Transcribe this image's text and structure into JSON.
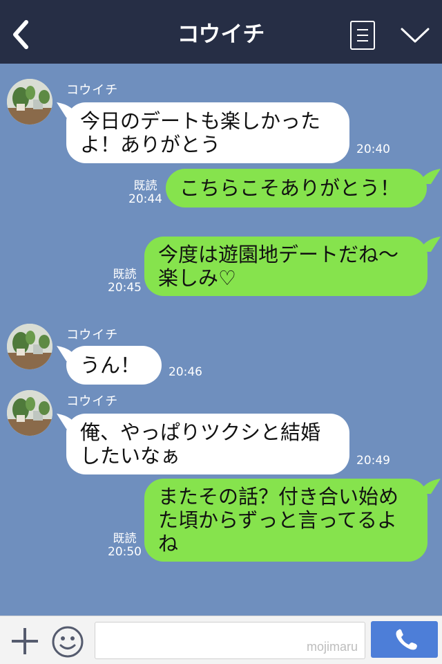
{
  "header": {
    "title": "コウイチ",
    "back_icon": "chevron-left-icon",
    "menu_icon": "list-menu-icon",
    "expand_icon": "chevron-down-icon"
  },
  "colors": {
    "header_bg": "#262e45",
    "chat_bg": "#6f8fbe",
    "incoming_bubble": "#ffffff",
    "outgoing_bubble": "#86e34d",
    "call_button": "#4d7ed8"
  },
  "messages": [
    {
      "direction": "in",
      "sender": "コウイチ",
      "lines": [
        "今日のデートも楽しかった",
        "よ！ありがとう"
      ],
      "time": "20:40"
    },
    {
      "direction": "out",
      "read": "既読",
      "lines": [
        "こちらこそありがとう！"
      ],
      "time": "20:44"
    },
    {
      "direction": "out",
      "read": "既読",
      "lines": [
        "今度は遊園地デートだね〜",
        "楽しみ♡"
      ],
      "time": "20:45"
    },
    {
      "direction": "in",
      "sender": "コウイチ",
      "lines": [
        "うん！"
      ],
      "time": "20:46"
    },
    {
      "direction": "in",
      "sender": "コウイチ",
      "lines": [
        "俺、やっぱりツクシと結婚",
        "したいなぁ"
      ],
      "time": "20:49"
    },
    {
      "direction": "out",
      "read": "既読",
      "lines": [
        "またその話？付き合い始め",
        "た頃からずっと言ってるよ",
        "ね"
      ],
      "time": "20:50"
    }
  ],
  "footer": {
    "plus_icon": "plus-icon",
    "emoji_icon": "smiley-icon",
    "input_value": "",
    "watermark": "mojimaru",
    "call_icon": "phone-icon"
  }
}
